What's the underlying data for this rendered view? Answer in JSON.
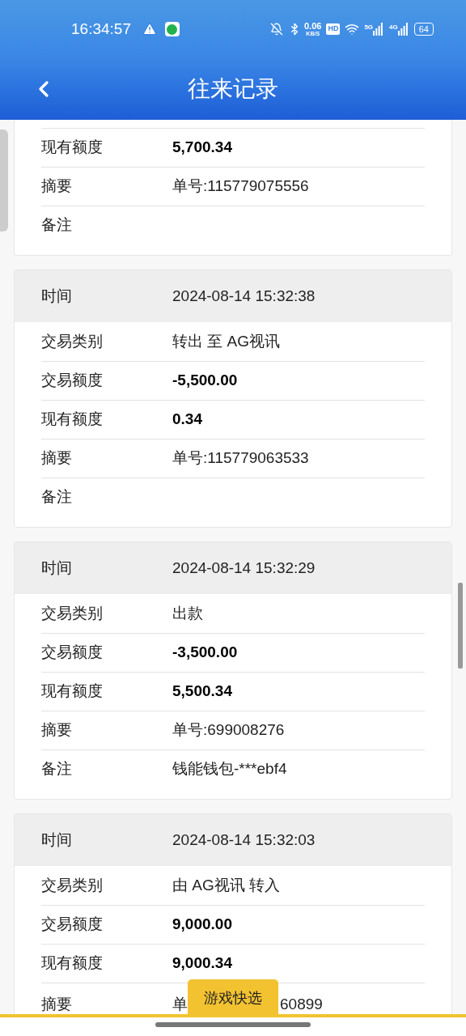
{
  "status_bar": {
    "time": "16:34:57",
    "speed": "0.06",
    "speed_unit": "KB/S",
    "hd": "HD",
    "net1": "5G",
    "net2": "4G",
    "battery": "64"
  },
  "nav": {
    "title": "往来记录"
  },
  "cards": [
    {
      "rows": [
        {
          "label": "现有额度",
          "value": "5,700.34",
          "kind": "amount"
        },
        {
          "label": "摘要",
          "value": "单号:115779075556",
          "kind": "text"
        },
        {
          "label": "备注",
          "kind": "text"
        }
      ]
    },
    {
      "header": {
        "label": "时间",
        "value": "2024-08-14 15:32:38"
      },
      "rows": [
        {
          "label": "交易类别",
          "value": "转出 至 AG视讯",
          "kind": "text"
        },
        {
          "label": "交易额度",
          "value": "-5,500.00",
          "kind": "amount"
        },
        {
          "label": "现有额度",
          "value": "0.34",
          "kind": "amount"
        },
        {
          "label": "摘要",
          "value": "单号:115779063533",
          "kind": "text"
        },
        {
          "label": "备注",
          "kind": "text"
        }
      ]
    },
    {
      "header": {
        "label": "时间",
        "value": "2024-08-14 15:32:29"
      },
      "rows": [
        {
          "label": "交易类别",
          "value": "出款",
          "kind": "text"
        },
        {
          "label": "交易额度",
          "value": "-3,500.00",
          "kind": "amount"
        },
        {
          "label": "现有额度",
          "value": "5,500.34",
          "kind": "amount"
        },
        {
          "label": "摘要",
          "value": "单号:699008276",
          "kind": "text"
        },
        {
          "label": "备注",
          "value": "钱能钱包-***ebf4",
          "kind": "text"
        }
      ]
    },
    {
      "header": {
        "label": "时间",
        "value": "2024-08-14 15:32:03"
      },
      "rows": [
        {
          "label": "交易类别",
          "value": "由 AG视讯 转入",
          "kind": "text"
        },
        {
          "label": "交易额度",
          "value": "9,000.00",
          "kind": "amount"
        },
        {
          "label": "现有额度",
          "value": "9,000.34",
          "kind": "amount"
        },
        {
          "label": "摘要",
          "value_parts": [
            "单",
            "60899"
          ],
          "kind": "text"
        }
      ]
    }
  ],
  "float_button": {
    "label": "游戏快选"
  }
}
